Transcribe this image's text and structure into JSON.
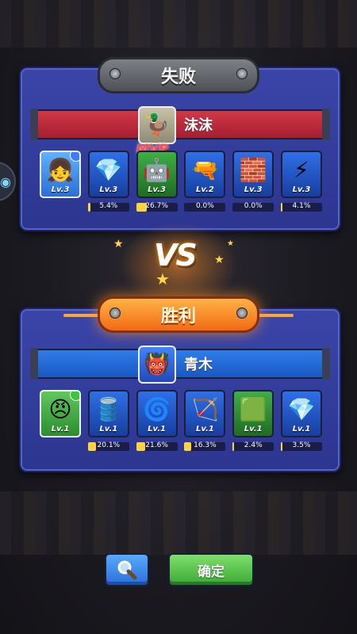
{
  "lose": {
    "title": "失败",
    "player_name": "沫沫",
    "mvp_label": "MVP",
    "cards": [
      {
        "kind": "hero",
        "level": "Lv.3",
        "icon": "pink-hair-hero-icon",
        "art": "👧",
        "pct": null
      },
      {
        "kind": "blue",
        "level": "Lv.3",
        "icon": "crystal-tower-icon",
        "art": "💎",
        "pct": "5.4%",
        "pct_value": 5.4
      },
      {
        "kind": "green",
        "level": "Lv.3",
        "icon": "machine-gun-tower-icon",
        "art": "🤖",
        "pct": "26.7%",
        "pct_value": 26.7
      },
      {
        "kind": "blue",
        "level": "Lv.2",
        "icon": "cannon-tower-icon",
        "art": "🔫",
        "pct": "0.0%",
        "pct_value": 0.0
      },
      {
        "kind": "blue",
        "level": "Lv.3",
        "icon": "red-bunker-tower-icon",
        "art": "🧱",
        "pct": "0.0%",
        "pct_value": 0.0
      },
      {
        "kind": "blue",
        "level": "Lv.3",
        "icon": "tesla-tower-icon",
        "art": "⚡",
        "pct": "4.1%",
        "pct_value": 4.1
      }
    ]
  },
  "vs_label": "VS",
  "win": {
    "title": "胜利",
    "player_name": "青木",
    "cards": [
      {
        "kind": "hero",
        "level": "Lv.1",
        "icon": "soldier-hero-icon",
        "art": "😠",
        "pct": null
      },
      {
        "kind": "blue",
        "level": "Lv.1",
        "icon": "drum-cannon-tower-icon",
        "art": "🛢️",
        "pct": "20.1%",
        "pct_value": 20.1
      },
      {
        "kind": "blue",
        "level": "Lv.1",
        "icon": "spring-tower-icon",
        "art": "🌀",
        "pct": "21.6%",
        "pct_value": 21.6
      },
      {
        "kind": "blue",
        "level": "Lv.1",
        "icon": "catapult-tower-icon",
        "art": "🏹",
        "pct": "16.3%",
        "pct_value": 16.3
      },
      {
        "kind": "green",
        "level": "Lv.1",
        "icon": "green-turret-tower-icon",
        "art": "🟩",
        "pct": "2.4%",
        "pct_value": 2.4
      },
      {
        "kind": "blue",
        "level": "Lv.1",
        "icon": "crystal-tower-icon",
        "art": "💎",
        "pct": "3.5%",
        "pct_value": 3.5
      }
    ]
  },
  "buttons": {
    "confirm_label": "确定",
    "search_icon": "magnifier-icon"
  },
  "colors": {
    "lose_bar": "#c42a3b",
    "win_bar": "#2468d8",
    "panel": "#3340a0",
    "progress": "#ffd43a"
  }
}
